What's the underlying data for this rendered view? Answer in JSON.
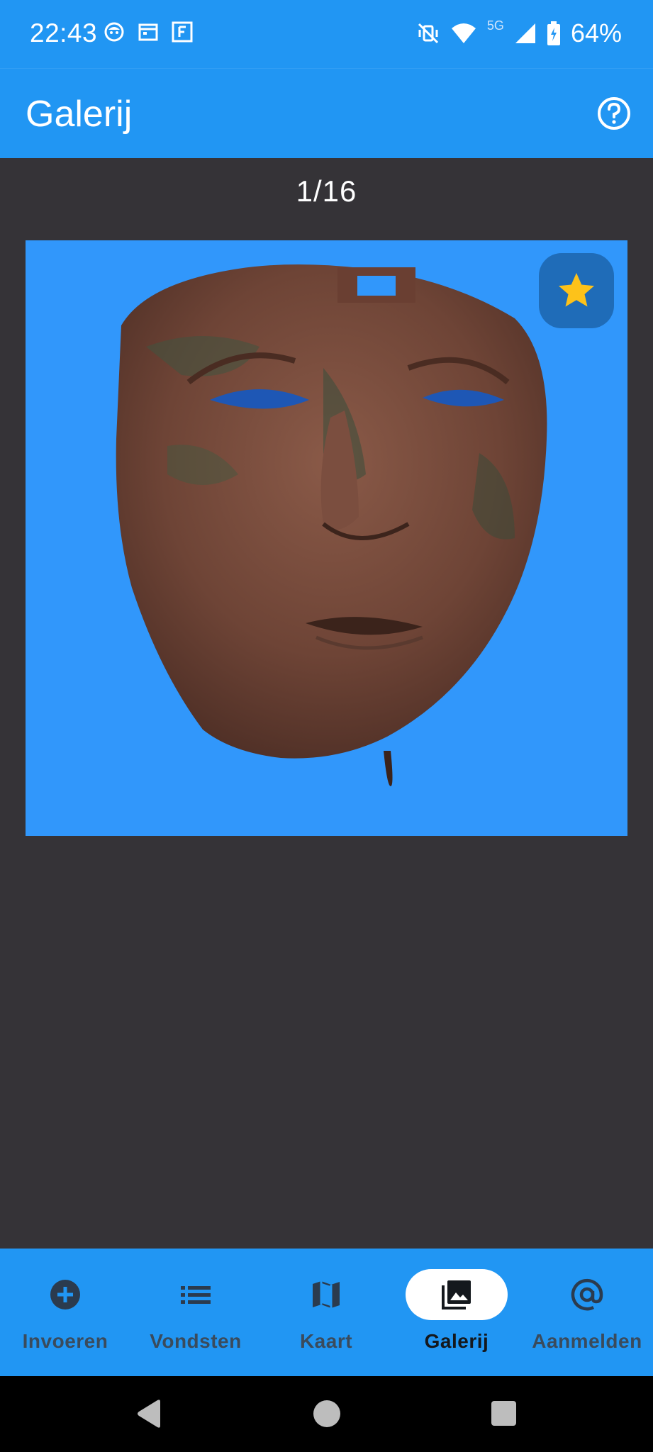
{
  "status_bar": {
    "time": "22:43",
    "network": "5G",
    "battery": "64%"
  },
  "app_bar": {
    "title": "Galerij"
  },
  "gallery": {
    "counter": "1/16",
    "image_alt": "bronze face mask",
    "is_favorite": true
  },
  "bottom_nav": {
    "items": [
      {
        "label": "Invoeren",
        "icon": "add-circle-icon"
      },
      {
        "label": "Vondsten",
        "icon": "list-icon"
      },
      {
        "label": "Kaart",
        "icon": "map-icon"
      },
      {
        "label": "Galerij",
        "icon": "photo-library-icon",
        "active": true
      },
      {
        "label": "Aanmelden",
        "icon": "at-sign-icon"
      }
    ]
  },
  "colors": {
    "primary": "#2196f3",
    "background": "#353337",
    "image_background": "#3197fb",
    "favorite_star": "#fdc21a"
  }
}
